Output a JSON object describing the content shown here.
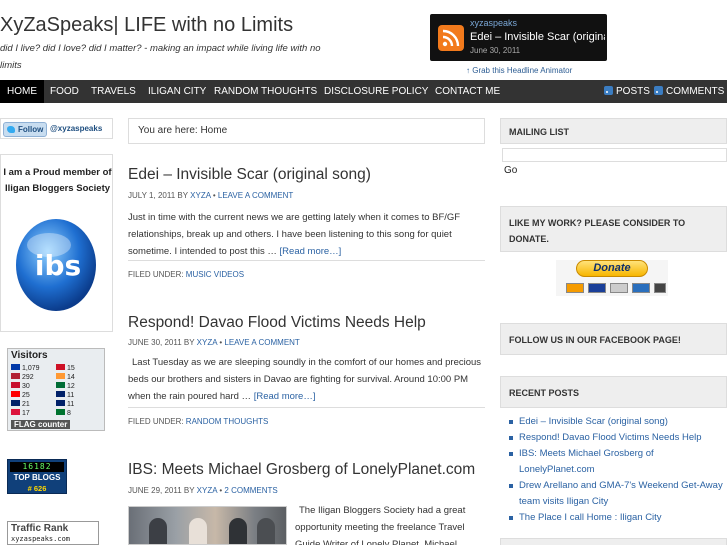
{
  "header": {
    "title": "XyZaSpeaks| LIFE with no Limits",
    "description": "did I live? did I love? did I matter? - making an impact while living life with no limits",
    "headline": {
      "site": "xyzaspeaks",
      "title": "Edei – Invisible Scar (original",
      "date": "June 30, 2011",
      "grab_link": "↑ Grab this Headline Animator"
    }
  },
  "nav": {
    "items": [
      "HOME",
      "FOOD",
      "TRAVELS",
      "ILIGAN CITY",
      "RANDOM THOUGHTS",
      "DISCLOSURE POLICY",
      "CONTACT ME"
    ],
    "posts_label": "POSTS",
    "comments_label": "COMMENTS"
  },
  "left_sidebar": {
    "follow_label": "Follow",
    "follow_handle": "@xyzaspeaks",
    "ibs_text": "I am a Proud member of Iligan Bloggers Society",
    "ibs_logo_text": "ibs",
    "visitors": {
      "title": "Visitors",
      "rows": [
        {
          "left": "1,079",
          "right": "15"
        },
        {
          "left": "292",
          "right": "14"
        },
        {
          "left": "30",
          "right": "12"
        },
        {
          "left": "25",
          "right": "11"
        },
        {
          "left": "21",
          "right": "11"
        },
        {
          "left": "17",
          "right": "8"
        }
      ],
      "flags_left": [
        "#0038a8",
        "#b22234",
        "#c8102e",
        "#fe0000",
        "#012169",
        "#dc143c"
      ],
      "flags_right": [
        "#ce1126",
        "#ff9933",
        "#006c35",
        "#012169",
        "#012169",
        "#00732f"
      ],
      "counter_label": "FLAG counter"
    },
    "top_blogs": {
      "digits": "16182",
      "label": "TOP BLOGS",
      "rank": "# 626"
    },
    "traffic": {
      "title": "Traffic Rank",
      "site": "xyzaspeaks.com"
    }
  },
  "main": {
    "breadcrumb": "You are here: Home",
    "posts": [
      {
        "title": "Edei – Invisible Scar (original song)",
        "date": "JULY 1, 2011",
        "by": "BY",
        "author": "XYZA",
        "comments": "LEAVE A COMMENT",
        "excerpt": "Just in time with the current news we are getting lately when it comes to BF/GF relationships, break up and others. I have been listening to this song for quiet sometime. I intended to post this …",
        "read_more": "[Read more…]",
        "filed_label": "FILED UNDER:",
        "category": "MUSIC VIDEOS"
      },
      {
        "title": "Respond! Davao Flood Victims Needs Help",
        "date": "JUNE 30, 2011",
        "by": "BY",
        "author": "XYZA",
        "comments": "LEAVE A COMMENT",
        "excerpt": "Last Tuesday as we are sleeping soundly in the comfort of our homes and precious beds our brothers and sisters in Davao are fighting for survival.  Around 10:00 PM when the rain poured hard …",
        "read_more": "[Read more…]",
        "filed_label": "FILED UNDER:",
        "category": "RANDOM THOUGHTS"
      },
      {
        "title": "IBS: Meets Michael Grosberg of LonelyPlanet.com",
        "date": "JUNE 29, 2011",
        "by": "BY",
        "author": "XYZA",
        "comments": "2 COMMENTS",
        "excerpt": "The Iligan Bloggers Society had a great opportunity meeting the freelance Travel Guide Writer of Lonely Planet, Michael"
      }
    ]
  },
  "right_sidebar": {
    "mailing_list_title": "MAILING LIST",
    "go_label": "Go",
    "donate_title": "LIKE MY WORK? PLEASE CONSIDER TO DONATE.",
    "donate_button": "Donate",
    "facebook_title": "FOLLOW US IN OUR FACEBOOK PAGE!",
    "recent_title": "RECENT POSTS",
    "recent_posts": [
      "Edei – Invisible Scar (original song)",
      "Respond! Davao Flood Victims Needs Help",
      "IBS: Meets Michael Grosberg of LonelyPlanet.com",
      "Drew Arellano and GMA-7's Weekend Get-Away team visits Iligan City",
      "The Place I call Home : Iligan City"
    ]
  },
  "colors": {
    "nav_bg": "#333333",
    "link": "#2b62a3",
    "rss_orange": "#f27a1c"
  }
}
